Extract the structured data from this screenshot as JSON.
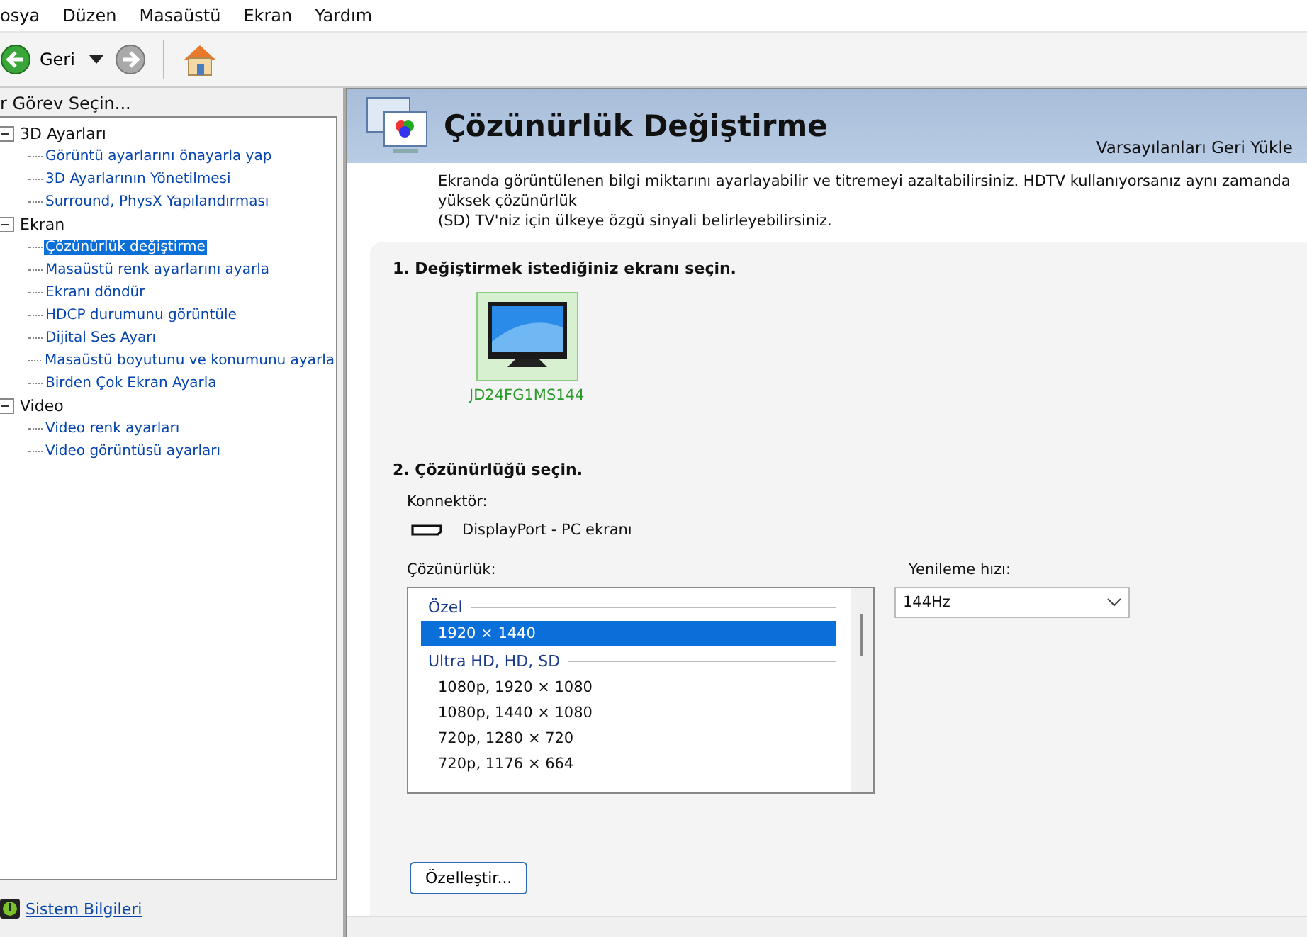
{
  "menu": [
    "osya",
    "Düzen",
    "Masaüstü",
    "Ekran",
    "Yardım"
  ],
  "toolbar": {
    "back_label": "Geri"
  },
  "sidebar": {
    "title": "r Görev Seçin...",
    "tree": [
      {
        "label": "3D Ayarları",
        "expanded": true,
        "children": [
          {
            "label": "Görüntü ayarlarını önayarla yap",
            "selected": false
          },
          {
            "label": "3D Ayarlarının Yönetilmesi",
            "selected": false
          },
          {
            "label": "Surround, PhysX Yapılandırması",
            "selected": false
          }
        ]
      },
      {
        "label": "Ekran",
        "expanded": true,
        "children": [
          {
            "label": "Çözünürlük değiştirme",
            "selected": true
          },
          {
            "label": "Masaüstü renk ayarlarını ayarla",
            "selected": false
          },
          {
            "label": "Ekranı döndür",
            "selected": false
          },
          {
            "label": "HDCP durumunu görüntüle",
            "selected": false
          },
          {
            "label": "Dijital Ses Ayarı",
            "selected": false
          },
          {
            "label": "Masaüstü boyutunu ve konumunu ayarla",
            "selected": false
          },
          {
            "label": "Birden Çok Ekran Ayarla",
            "selected": false
          }
        ]
      },
      {
        "label": "Video",
        "expanded": true,
        "children": [
          {
            "label": "Video renk ayarları",
            "selected": false
          },
          {
            "label": "Video görüntüsü ayarları",
            "selected": false
          }
        ]
      }
    ],
    "footer_link": "Sistem Bilgileri"
  },
  "header": {
    "title": "Çözünürlük Değiştirme",
    "restore_link": "Varsayılanları Geri Yükle"
  },
  "description": "Ekranda görüntülenen bilgi miktarını ayarlayabilir ve titremeyi azaltabilirsiniz. HDTV kullanıyorsanız aynı zamanda yüksek çözünürlük\n(SD) TV'niz için ülkeye özgü sinyali belirleyebilirsiniz.",
  "step1": {
    "heading": "1. Değiştirmek istediğiniz ekranı seçin.",
    "displays": [
      {
        "label": "JD24FG1MS144",
        "selected": true
      }
    ]
  },
  "step2": {
    "heading": "2. Çözünürlüğü seçin.",
    "connector_label": "Konnektör:",
    "connector": "DisplayPort - PC ekranı",
    "resolution_label": "Çözünürlük:",
    "resolutions": [
      {
        "kind": "group",
        "label": "Özel"
      },
      {
        "kind": "item",
        "label": "1920 × 1440",
        "selected": true
      },
      {
        "kind": "group",
        "label": "Ultra HD, HD, SD"
      },
      {
        "kind": "item",
        "label": "1080p, 1920 × 1080",
        "selected": false
      },
      {
        "kind": "item",
        "label": "1080p, 1440 × 1080",
        "selected": false
      },
      {
        "kind": "item",
        "label": "720p, 1280 × 720",
        "selected": false
      },
      {
        "kind": "item",
        "label": "720p, 1176 × 664",
        "selected": false
      }
    ],
    "refresh_label": "Yenileme hızı:",
    "refresh_value": "144Hz",
    "customize_button": "Özelleştir..."
  }
}
